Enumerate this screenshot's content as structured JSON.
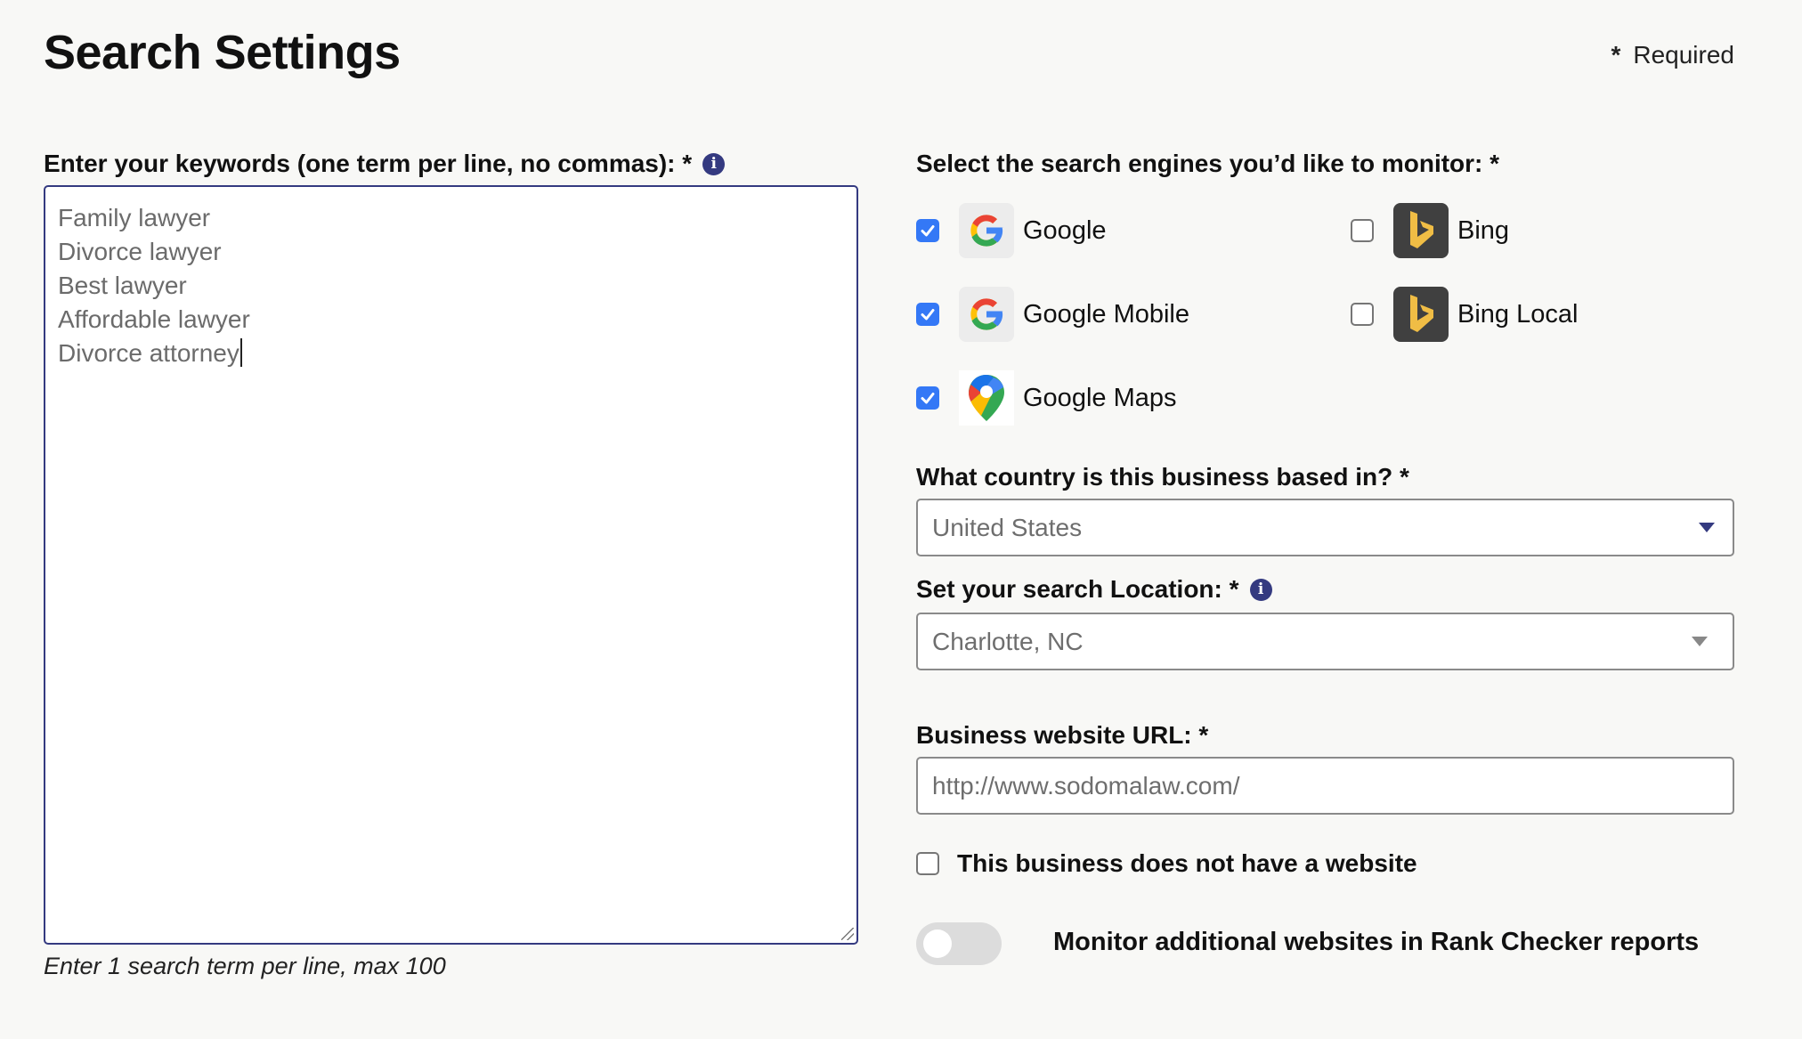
{
  "header": {
    "title": "Search Settings",
    "required_marker": "*",
    "required_label": "Required"
  },
  "keywords": {
    "label": "Enter your keywords (one term per line, no commas): *",
    "info_icon": "info-icon",
    "values": [
      "Family lawyer",
      "Divorce lawyer",
      "Best lawyer",
      "Affordable lawyer",
      "Divorce attorney"
    ],
    "helper": "Enter 1 search term per line, max 100"
  },
  "engines": {
    "label": "Select the search engines you’d like to monitor: *",
    "items": [
      {
        "name": "Google",
        "checked": true,
        "icon": "google-icon"
      },
      {
        "name": "Google Mobile",
        "checked": true,
        "icon": "google-icon"
      },
      {
        "name": "Google Maps",
        "checked": true,
        "icon": "google-maps-icon"
      },
      {
        "name": "Bing",
        "checked": false,
        "icon": "bing-icon"
      },
      {
        "name": "Bing Local",
        "checked": false,
        "icon": "bing-icon"
      }
    ]
  },
  "country": {
    "label": "What country is this business based in? *",
    "value": "United States"
  },
  "location": {
    "label": "Set your search Location: *",
    "info_icon": "info-icon",
    "value": "Charlotte, NC"
  },
  "website": {
    "label": "Business website URL: *",
    "placeholder": "http://www.sodomalaw.com/",
    "no_website_label": "This business does not have a website",
    "no_website_checked": false
  },
  "monitor": {
    "label": "Monitor additional websites in Rank Checker reports",
    "enabled": false
  },
  "colors": {
    "accent": "#343a80",
    "checkbox": "#3478f6",
    "background": "#f8f8f6",
    "bing_yellow": "#f0bd45"
  }
}
